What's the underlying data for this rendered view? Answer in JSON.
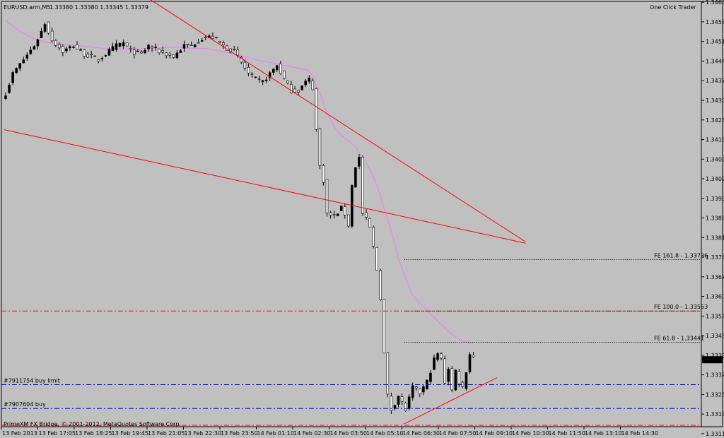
{
  "header": {
    "symbol": "EURUSD.arm,M5",
    "ohlc": "1.33380 1.33380 1.33345 1.33379",
    "one_click": "One Click Trader"
  },
  "footer": {
    "copyright": "PrimeXM FX Bridge, © 2001-2012, MetaQuotes Software Corp."
  },
  "colors": {
    "background": "#c0c0c0",
    "candle": "#000000",
    "ma": "#ee82ee",
    "trendline": "#ff0000",
    "order_line": "#0000ff",
    "level_line": "#ff0000",
    "grid": "#8c8c8c"
  },
  "chart_data": {
    "type": "candlestick",
    "ylim": [
      1.3314,
      1.34658
    ],
    "y_ticks": [
      "1.34655",
      "1.34585",
      "1.34515",
      "1.34445",
      "1.34375",
      "1.34305",
      "1.34235",
      "1.34165",
      "1.34095",
      "1.34025",
      "1.33955",
      "1.33885",
      "1.33815",
      "1.33745",
      "1.33675",
      "1.33605",
      "1.33535",
      "1.33465",
      "1.33395",
      "1.33325",
      "1.33255",
      "1.33185",
      "1.33115"
    ],
    "x_labels": [
      "13 Feb 2013",
      "13 Feb 17:05",
      "13 Feb 18:25",
      "13 Feb 19:45",
      "13 Feb 21:05",
      "13 Feb 22:30",
      "13 Feb 23:50",
      "14 Feb 01:10",
      "14 Feb 02:30",
      "14 Feb 03:50",
      "14 Feb 05:10",
      "14 Feb 06:30",
      "14 Feb 07:50",
      "14 Feb 09:10",
      "14 Feb 10:30",
      "14 Feb 11:50",
      "14 Feb 13:10",
      "14 Feb 14:30"
    ],
    "current_price": "1.33379",
    "price_path": [
      [
        0,
        1.3433
      ],
      [
        2,
        1.344
      ],
      [
        5,
        1.3445
      ],
      [
        8,
        1.345
      ],
      [
        10,
        1.3455
      ],
      [
        11,
        1.3458
      ],
      [
        13,
        1.3452
      ],
      [
        16,
        1.3448
      ],
      [
        19,
        1.345
      ],
      [
        22,
        1.3447
      ],
      [
        26,
        1.3445
      ],
      [
        28,
        1.3447
      ],
      [
        31,
        1.345
      ],
      [
        33,
        1.3451
      ],
      [
        35,
        1.3448
      ],
      [
        38,
        1.3447
      ],
      [
        40,
        1.345
      ],
      [
        43,
        1.3448
      ],
      [
        45,
        1.3447
      ],
      [
        47,
        1.3446
      ],
      [
        50,
        1.345
      ],
      [
        52,
        1.345
      ],
      [
        54,
        1.3452
      ],
      [
        56,
        1.3453
      ],
      [
        58,
        1.3453
      ],
      [
        60,
        1.3451
      ],
      [
        62,
        1.3449
      ],
      [
        64,
        1.3448
      ],
      [
        66,
        1.3444
      ],
      [
        68,
        1.344
      ],
      [
        70,
        1.3438
      ],
      [
        72,
        1.3437
      ],
      [
        74,
        1.344
      ],
      [
        76,
        1.3443
      ],
      [
        78,
        1.3438
      ],
      [
        80,
        1.3434
      ],
      [
        82,
        1.3434
      ],
      [
        84,
        1.3437
      ],
      [
        85,
        1.3438
      ],
      [
        86,
        1.3435
      ],
      [
        87,
        1.342
      ],
      [
        88,
        1.3407
      ],
      [
        89,
        1.3402
      ],
      [
        90,
        1.339
      ],
      [
        92,
        1.3389
      ],
      [
        94,
        1.3392
      ],
      [
        95,
        1.339
      ],
      [
        96,
        1.3386
      ],
      [
        97,
        1.34
      ],
      [
        98,
        1.3407
      ],
      [
        99,
        1.341
      ],
      [
        100,
        1.339
      ],
      [
        101,
        1.3388
      ],
      [
        102,
        1.3385
      ],
      [
        103,
        1.3378
      ],
      [
        104,
        1.337
      ],
      [
        105,
        1.336
      ],
      [
        106,
        1.334
      ],
      [
        107,
        1.3325
      ],
      [
        108,
        1.332
      ],
      [
        110,
        1.3325
      ],
      [
        112,
        1.332
      ],
      [
        114,
        1.3328
      ],
      [
        116,
        1.3326
      ],
      [
        118,
        1.333
      ],
      [
        120,
        1.3338
      ],
      [
        121,
        1.334
      ],
      [
        122,
        1.3338
      ],
      [
        123,
        1.333
      ],
      [
        124,
        1.3335
      ],
      [
        125,
        1.3327
      ],
      [
        126,
        1.3334
      ],
      [
        127,
        1.333
      ],
      [
        128,
        1.3328
      ],
      [
        129,
        1.3334
      ],
      [
        130,
        1.334
      ],
      [
        131,
        1.3339
      ]
    ],
    "moving_average": [
      [
        0,
        1.3459
      ],
      [
        4,
        1.3455
      ],
      [
        8,
        1.34525
      ],
      [
        12,
        1.3451
      ],
      [
        16,
        1.34505
      ],
      [
        20,
        1.345
      ],
      [
        24,
        1.34495
      ],
      [
        28,
        1.3449
      ],
      [
        32,
        1.34488
      ],
      [
        36,
        1.34488
      ],
      [
        40,
        1.3449
      ],
      [
        44,
        1.34493
      ],
      [
        48,
        1.34495
      ],
      [
        52,
        1.3449
      ],
      [
        56,
        1.3449
      ],
      [
        60,
        1.3448
      ],
      [
        64,
        1.3447
      ],
      [
        68,
        1.34455
      ],
      [
        72,
        1.34445
      ],
      [
        76,
        1.34435
      ],
      [
        80,
        1.34425
      ],
      [
        84,
        1.34415
      ],
      [
        85,
        1.3441
      ],
      [
        86,
        1.3439
      ],
      [
        88,
        1.3433
      ],
      [
        90,
        1.3426
      ],
      [
        92,
        1.3421
      ],
      [
        94,
        1.3418
      ],
      [
        96,
        1.3416
      ],
      [
        98,
        1.3414
      ],
      [
        100,
        1.341
      ],
      [
        102,
        1.3406
      ],
      [
        104,
        1.34
      ],
      [
        106,
        1.3392
      ],
      [
        108,
        1.3384
      ],
      [
        110,
        1.3374
      ],
      [
        112,
        1.3367
      ],
      [
        114,
        1.3361
      ],
      [
        116,
        1.3358
      ],
      [
        118,
        1.33555
      ],
      [
        120,
        1.3353
      ],
      [
        122,
        1.33505
      ],
      [
        124,
        1.3348
      ],
      [
        126,
        1.3346
      ],
      [
        128,
        1.33445
      ],
      [
        130,
        1.3344
      ],
      [
        131,
        1.33438
      ]
    ],
    "horizontal_lines": [
      {
        "label": "",
        "price": 1.33553,
        "style": "dashdot",
        "color": "#ff0000"
      },
      {
        "label": "#7911754 buy limit",
        "price": 1.3329,
        "style": "dashdot",
        "color": "#0000ff"
      },
      {
        "label": "#7907604 buy",
        "price": 1.33205,
        "style": "dashdot",
        "color": "#0000ff"
      },
      {
        "label": "",
        "price": 1.33145,
        "style": "dashdot",
        "color": "#ff0000"
      }
    ],
    "fibonacci_levels": [
      {
        "label": "FE 161.8 - 1.33736",
        "price": 1.33736,
        "x_start_bar": 112
      },
      {
        "label": "FE 100.0 - 1.33553",
        "price": 1.33553,
        "x_start_bar": 112
      },
      {
        "label": "FE 61.8 - 1.33441",
        "price": 1.33441,
        "x_start_bar": 112
      }
    ],
    "trendlines": [
      {
        "from": [
          39,
          1.3468
        ],
        "to": [
          146,
          1.338
        ]
      },
      {
        "from": [
          0,
          1.342
        ],
        "to": [
          146,
          1.33795
        ]
      },
      {
        "from": [
          112,
          1.3315
        ],
        "to": [
          138,
          1.33315
        ]
      }
    ]
  }
}
